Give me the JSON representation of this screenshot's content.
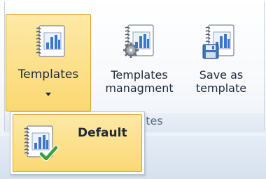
{
  "ribbon": {
    "group_label": "Templates",
    "buttons": {
      "templates": {
        "label": "Templates",
        "icon": "template-chart-icon"
      },
      "management": {
        "line1": "Templates",
        "line2": "managment",
        "icon": "template-settings-icon"
      },
      "save": {
        "line1": "Save as",
        "line2": "template",
        "icon": "save-template-icon"
      }
    }
  },
  "dropdown": {
    "items": [
      {
        "label": "Default",
        "icon": "default-template-check-icon"
      }
    ]
  },
  "colors": {
    "highlight": "#fbd873",
    "highlight_border": "#d6a53a",
    "chart_blue": "#3a78c9",
    "check_green": "#3aa03a"
  }
}
